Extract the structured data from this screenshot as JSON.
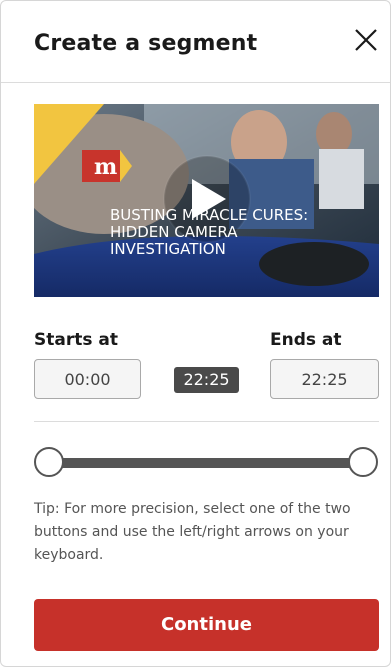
{
  "header": {
    "title": "Create a segment",
    "close_icon": "close-icon"
  },
  "video": {
    "brand_mark": "m",
    "caption_lines": [
      "BUSTING MIRACLE CURES:",
      "HIDDEN CAMERA",
      "INVESTIGATION"
    ],
    "play_icon": "play-icon",
    "brand_color": "#c8342c",
    "corner_color": "#f2c540"
  },
  "segment": {
    "starts_label": "Starts at",
    "ends_label": "Ends at",
    "start_value": "00:00",
    "end_value": "22:25",
    "duration": "22:25",
    "slider_start_fraction": 0,
    "slider_end_fraction": 1
  },
  "tip": "Tip: For more precision, select one of the two buttons and use the left/right arrows on your keyboard.",
  "actions": {
    "continue_label": "Continue",
    "accent_color": "#c6312a"
  }
}
